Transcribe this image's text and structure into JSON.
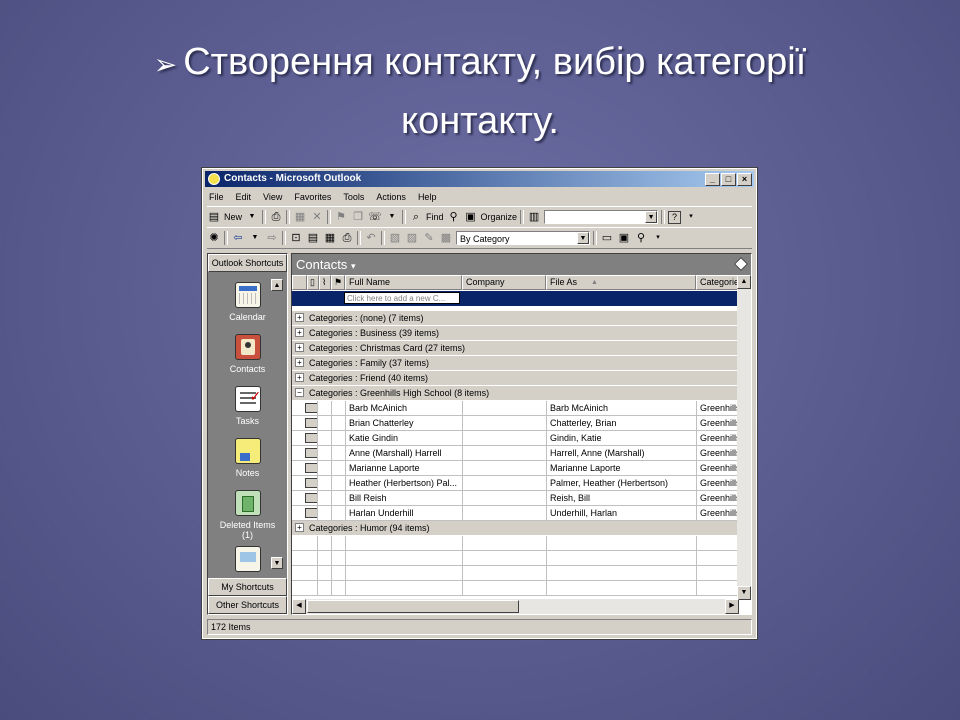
{
  "slide": {
    "title_line1": "Створення контакту, вибір категорії",
    "title_line2": "контакту."
  },
  "window": {
    "title": "Contacts - Microsoft Outlook",
    "controls": [
      "_",
      "□",
      "×"
    ]
  },
  "menu": [
    "File",
    "Edit",
    "View",
    "Favorites",
    "Tools",
    "Actions",
    "Help"
  ],
  "toolbar1": {
    "new_label": "New",
    "find_label": "Find",
    "organize_label": "Organize",
    "address_value": ""
  },
  "toolbar2": {
    "view_value": "By Category"
  },
  "sidebar": {
    "header": "Outlook Shortcuts",
    "items": [
      {
        "label": "Calendar",
        "icon": "calendar-icon"
      },
      {
        "label": "Contacts",
        "icon": "contacts-icon"
      },
      {
        "label": "Tasks",
        "icon": "tasks-icon"
      },
      {
        "label": "Notes",
        "icon": "notes-icon"
      },
      {
        "label": "Deleted Items (1)",
        "icon": "deleted-items-icon"
      }
    ],
    "my_shortcuts": "My Shortcuts",
    "other_shortcuts": "Other Shortcuts"
  },
  "folder": {
    "name": "Contacts"
  },
  "columns": [
    "Full Name",
    "Company",
    "File As",
    "Categorie"
  ],
  "new_row_placeholder": "Click here to add a new C...",
  "groups_before": [
    {
      "sign": "+",
      "text": "Categories : (none) (7 items)"
    },
    {
      "sign": "+",
      "text": "Categories : Business (39 items)"
    },
    {
      "sign": "+",
      "text": "Categories : Christmas Card (27 items)"
    },
    {
      "sign": "+",
      "text": "Categories : Family (37 items)"
    },
    {
      "sign": "+",
      "text": "Categories : Friend (40 items)"
    },
    {
      "sign": "−",
      "text": "Categories : Greenhills High School (8 items)"
    }
  ],
  "contacts": [
    {
      "full_name": "Barb McAinich",
      "company": "",
      "file_as": "Barb McAinich",
      "category": "Greenhills"
    },
    {
      "full_name": "Brian Chatterley",
      "company": "",
      "file_as": "Chatterley, Brian",
      "category": "Greenhills"
    },
    {
      "full_name": "Katie Gindin",
      "company": "",
      "file_as": "Gindin, Katie",
      "category": "Greenhills"
    },
    {
      "full_name": "Anne (Marshall) Harrell",
      "company": "",
      "file_as": "Harrell, Anne (Marshall)",
      "category": "Greenhills"
    },
    {
      "full_name": "Marianne Laporte",
      "company": "",
      "file_as": "Marianne Laporte",
      "category": "Greenhills"
    },
    {
      "full_name": "Heather (Herbertson) Pal...",
      "company": "",
      "file_as": "Palmer, Heather (Herbertson)",
      "category": "Greenhills"
    },
    {
      "full_name": "Bill Reish",
      "company": "",
      "file_as": "Reish, Bill",
      "category": "Greenhills"
    },
    {
      "full_name": "Harlan Underhill",
      "company": "",
      "file_as": "Underhill, Harlan",
      "category": "Greenhills"
    }
  ],
  "groups_after": [
    {
      "sign": "+",
      "text": "Categories : Humor (94 items)"
    }
  ],
  "status": "172 Items"
}
